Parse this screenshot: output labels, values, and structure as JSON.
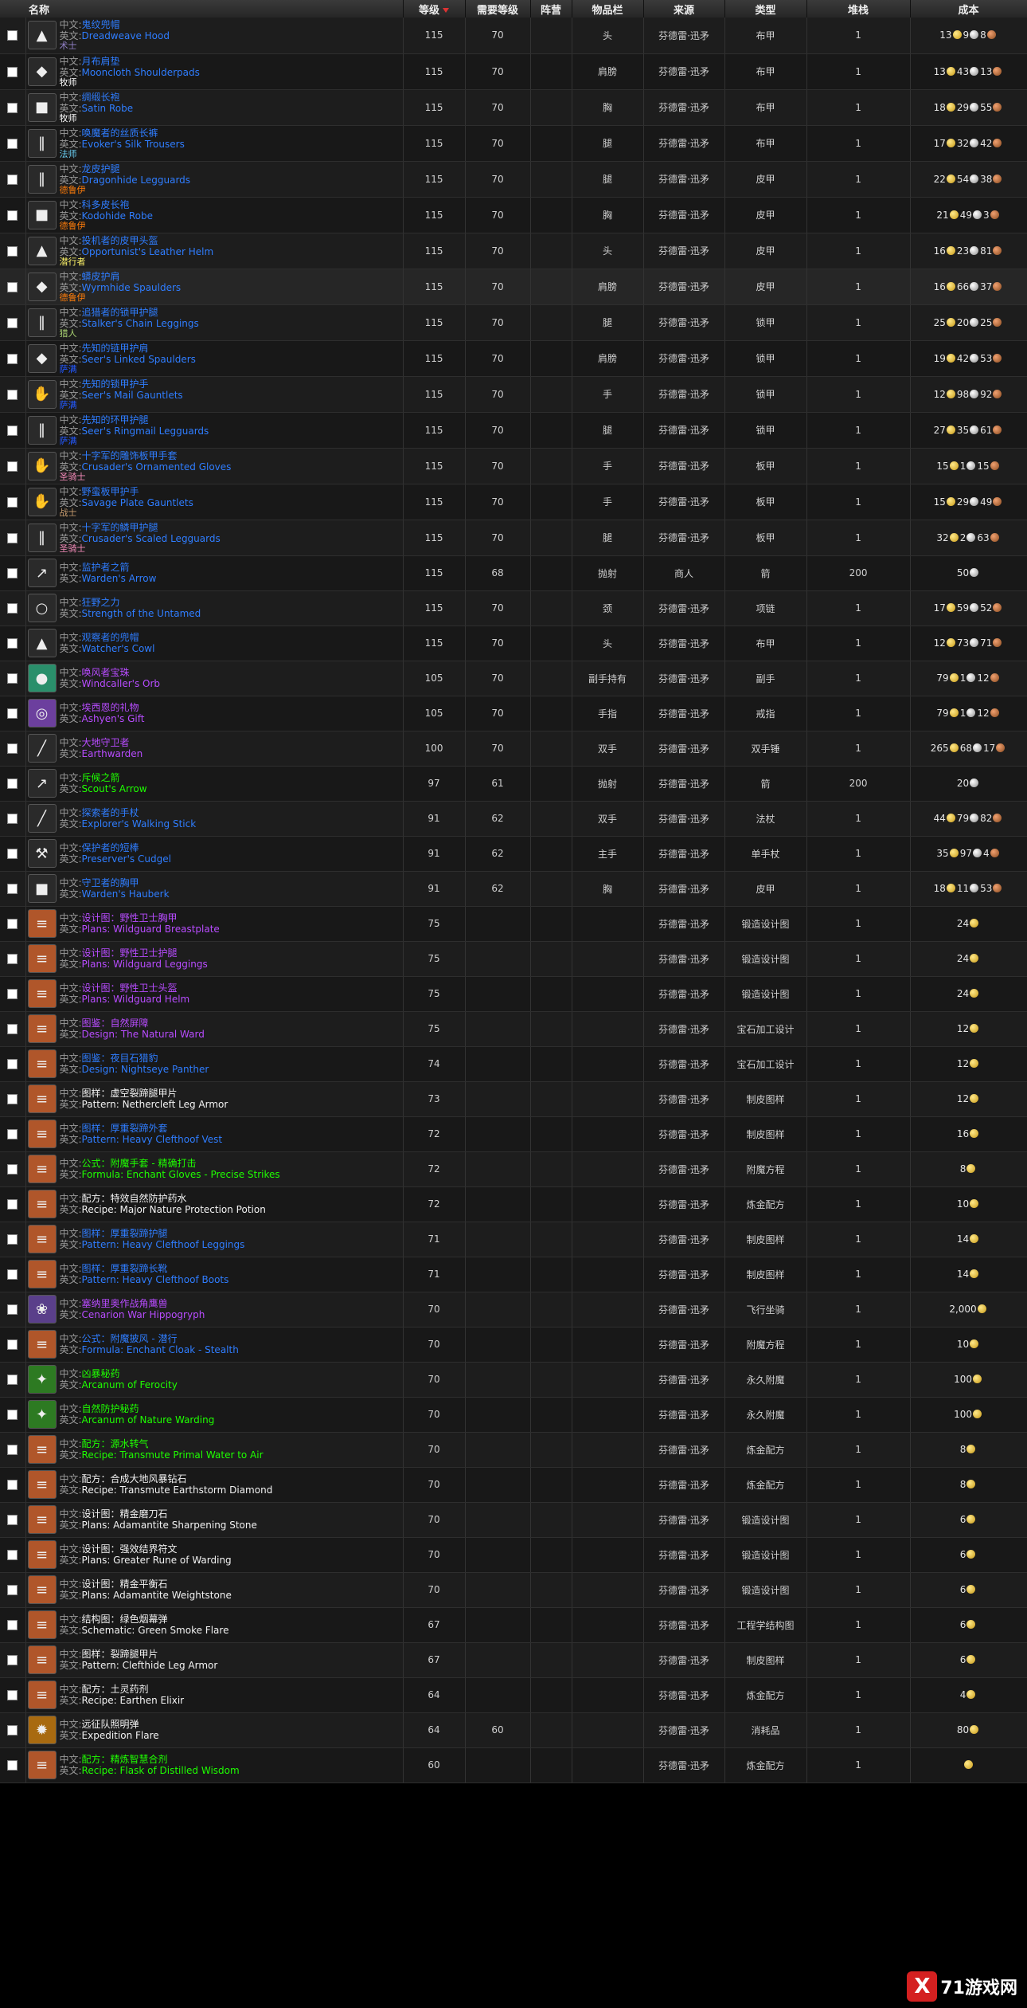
{
  "header": {
    "col_name": "名称",
    "col_level": "等级",
    "col_req_level": "需要等级",
    "col_faction": "阵营",
    "col_slot": "物品栏",
    "col_source": "来源",
    "col_type": "类型",
    "col_stack": "堆栈",
    "col_cost": "成本"
  },
  "labels": {
    "zh": "中文:",
    "en": "英文:"
  },
  "colors": {
    "blue": "#2f7dff",
    "purple": "#b84cff",
    "green": "#1eff00",
    "white": "#f2f2f2"
  },
  "watermark": {
    "logo": "X",
    "text": "71游戏网"
  },
  "rows": [
    {
      "icon": "hood-icon",
      "zh": "鬼纹兜帽",
      "en": "Dreadweave Hood",
      "cls": "术士",
      "cls_color": "#9482c9",
      "q": "blue",
      "level": "115",
      "req": "70",
      "slot": "头",
      "source": "芬德雷·迅矛",
      "type": "布甲",
      "stack": "1",
      "cost": {
        "g": "13",
        "s": "9",
        "c": "8"
      }
    },
    {
      "icon": "shoulder-icon",
      "zh": "月布肩垫",
      "en": "Mooncloth Shoulderpads",
      "cls": "牧师",
      "cls_color": "#ffffff",
      "q": "blue",
      "level": "115",
      "req": "70",
      "slot": "肩膀",
      "source": "芬德雷·迅矛",
      "type": "布甲",
      "stack": "1",
      "cost": {
        "g": "13",
        "s": "43",
        "c": "13"
      }
    },
    {
      "icon": "robe-icon",
      "zh": "绸缎长袍",
      "en": "Satin Robe",
      "cls": "牧师",
      "cls_color": "#ffffff",
      "q": "blue",
      "level": "115",
      "req": "70",
      "slot": "胸",
      "source": "芬德雷·迅矛",
      "type": "布甲",
      "stack": "1",
      "cost": {
        "g": "18",
        "s": "29",
        "c": "55"
      }
    },
    {
      "icon": "trousers-icon",
      "zh": "唤魔者的丝质长裤",
      "en": "Evoker's Silk Trousers",
      "cls": "法师",
      "cls_color": "#69ccf0",
      "q": "blue",
      "level": "115",
      "req": "70",
      "slot": "腿",
      "source": "芬德雷·迅矛",
      "type": "布甲",
      "stack": "1",
      "cost": {
        "g": "17",
        "s": "32",
        "c": "42"
      }
    },
    {
      "icon": "leggings-icon",
      "zh": "龙皮护腿",
      "en": "Dragonhide Legguards",
      "cls": "德鲁伊",
      "cls_color": "#ff7d0a",
      "q": "blue",
      "level": "115",
      "req": "70",
      "slot": "腿",
      "source": "芬德雷·迅矛",
      "type": "皮甲",
      "stack": "1",
      "cost": {
        "g": "22",
        "s": "54",
        "c": "38"
      }
    },
    {
      "icon": "robe-icon",
      "zh": "科多皮长袍",
      "en": "Kodohide Robe",
      "cls": "德鲁伊",
      "cls_color": "#ff7d0a",
      "q": "blue",
      "level": "115",
      "req": "70",
      "slot": "胸",
      "source": "芬德雷·迅矛",
      "type": "皮甲",
      "stack": "1",
      "cost": {
        "g": "21",
        "s": "49",
        "c": "3"
      }
    },
    {
      "icon": "helm-icon",
      "zh": "投机者的皮甲头盔",
      "en": "Opportunist's Leather Helm",
      "cls": "潜行者",
      "cls_color": "#fff569",
      "q": "blue",
      "level": "115",
      "req": "70",
      "slot": "头",
      "source": "芬德雷·迅矛",
      "type": "皮甲",
      "stack": "1",
      "cost": {
        "g": "16",
        "s": "23",
        "c": "81"
      }
    },
    {
      "icon": "shoulder-icon",
      "zh": "蟒皮护肩",
      "en": "Wyrmhide Spaulders",
      "cls": "德鲁伊",
      "cls_color": "#ff7d0a",
      "q": "blue",
      "level": "115",
      "req": "70",
      "slot": "肩膀",
      "source": "芬德雷·迅矛",
      "type": "皮甲",
      "stack": "1",
      "cost": {
        "g": "16",
        "s": "66",
        "c": "37"
      },
      "hl": true
    },
    {
      "icon": "leggings-icon",
      "zh": "追猎者的锁甲护腿",
      "en": "Stalker's Chain Leggings",
      "cls": "猎人",
      "cls_color": "#abd473",
      "q": "blue",
      "level": "115",
      "req": "70",
      "slot": "腿",
      "source": "芬德雷·迅矛",
      "type": "锁甲",
      "stack": "1",
      "cost": {
        "g": "25",
        "s": "20",
        "c": "25"
      }
    },
    {
      "icon": "shoulder-icon",
      "zh": "先知的链甲护肩",
      "en": "Seer's Linked Spaulders",
      "cls": "萨满",
      "cls_color": "#2459ff",
      "q": "blue",
      "level": "115",
      "req": "70",
      "slot": "肩膀",
      "source": "芬德雷·迅矛",
      "type": "锁甲",
      "stack": "1",
      "cost": {
        "g": "19",
        "s": "42",
        "c": "53"
      }
    },
    {
      "icon": "gauntlets-icon",
      "zh": "先知的锁甲护手",
      "en": "Seer's Mail Gauntlets",
      "cls": "萨满",
      "cls_color": "#2459ff",
      "q": "blue",
      "level": "115",
      "req": "70",
      "slot": "手",
      "source": "芬德雷·迅矛",
      "type": "锁甲",
      "stack": "1",
      "cost": {
        "g": "12",
        "s": "98",
        "c": "92"
      }
    },
    {
      "icon": "leggings-icon",
      "zh": "先知的环甲护腿",
      "en": "Seer's Ringmail Legguards",
      "cls": "萨满",
      "cls_color": "#2459ff",
      "q": "blue",
      "level": "115",
      "req": "70",
      "slot": "腿",
      "source": "芬德雷·迅矛",
      "type": "锁甲",
      "stack": "1",
      "cost": {
        "g": "27",
        "s": "35",
        "c": "61"
      }
    },
    {
      "icon": "gauntlets-icon",
      "zh": "十字军的雕饰板甲手套",
      "en": "Crusader's Ornamented Gloves",
      "cls": "圣骑士",
      "cls_color": "#f58cba",
      "q": "blue",
      "level": "115",
      "req": "70",
      "slot": "手",
      "source": "芬德雷·迅矛",
      "type": "板甲",
      "stack": "1",
      "cost": {
        "g": "15",
        "s": "1",
        "c": "15"
      }
    },
    {
      "icon": "gauntlets-icon",
      "zh": "野蛮板甲护手",
      "en": "Savage Plate Gauntlets",
      "cls": "战士",
      "cls_color": "#c79c6e",
      "q": "blue",
      "level": "115",
      "req": "70",
      "slot": "手",
      "source": "芬德雷·迅矛",
      "type": "板甲",
      "stack": "1",
      "cost": {
        "g": "15",
        "s": "29",
        "c": "49"
      }
    },
    {
      "icon": "leggings-icon",
      "zh": "十字军的鳞甲护腿",
      "en": "Crusader's Scaled Legguards",
      "cls": "圣骑士",
      "cls_color": "#f58cba",
      "q": "blue",
      "level": "115",
      "req": "70",
      "slot": "腿",
      "source": "芬德雷·迅矛",
      "type": "板甲",
      "stack": "1",
      "cost": {
        "g": "32",
        "s": "2",
        "c": "63"
      }
    },
    {
      "icon": "arrow-icon",
      "zh": "监护者之箭",
      "en": "Warden's Arrow",
      "cls": "",
      "cls_color": "",
      "q": "blue",
      "level": "115",
      "req": "68",
      "slot": "抛射",
      "source": "商人",
      "type": "箭",
      "stack": "200",
      "cost": {
        "s": "50"
      },
      "short": true
    },
    {
      "icon": "necklace-icon",
      "zh": "狂野之力",
      "en": "Strength of the Untamed",
      "cls": "",
      "cls_color": "",
      "q": "blue",
      "level": "115",
      "req": "70",
      "slot": "颈",
      "source": "芬德雷·迅矛",
      "type": "项链",
      "stack": "1",
      "cost": {
        "g": "17",
        "s": "59",
        "c": "52"
      },
      "short": true
    },
    {
      "icon": "hood-icon",
      "zh": "观察者的兜帽",
      "en": "Watcher's Cowl",
      "cls": "",
      "cls_color": "",
      "q": "blue",
      "level": "115",
      "req": "70",
      "slot": "头",
      "source": "芬德雷·迅矛",
      "type": "布甲",
      "stack": "1",
      "cost": {
        "g": "12",
        "s": "73",
        "c": "71"
      },
      "short": true
    },
    {
      "icon": "orb-icon",
      "zh": "唤风者宝珠",
      "en": "Windcaller's Orb",
      "cls": "",
      "cls_color": "",
      "q": "purple",
      "level": "105",
      "req": "70",
      "slot": "副手持有",
      "source": "芬德雷·迅矛",
      "type": "副手",
      "stack": "1",
      "cost": {
        "g": "79",
        "s": "1",
        "c": "12"
      },
      "short": true
    },
    {
      "icon": "ring-icon",
      "zh": "埃西恩的礼物",
      "en": "Ashyen's Gift",
      "cls": "",
      "cls_color": "",
      "q": "purple",
      "level": "105",
      "req": "70",
      "slot": "手指",
      "source": "芬德雷·迅矛",
      "type": "戒指",
      "stack": "1",
      "cost": {
        "g": "79",
        "s": "1",
        "c": "12"
      },
      "short": true
    },
    {
      "icon": "staff-icon",
      "zh": "大地守卫者",
      "en": "Earthwarden",
      "cls": "",
      "cls_color": "",
      "q": "purple",
      "level": "100",
      "req": "70",
      "slot": "双手",
      "source": "芬德雷·迅矛",
      "type": "双手锤",
      "stack": "1",
      "cost": {
        "g": "265",
        "s": "68",
        "c": "17"
      },
      "short": true
    },
    {
      "icon": "arrow-icon",
      "zh": "斥候之箭",
      "en": "Scout's Arrow",
      "cls": "",
      "cls_color": "",
      "q": "green",
      "level": "97",
      "req": "61",
      "slot": "抛射",
      "source": "芬德雷·迅矛",
      "type": "箭",
      "stack": "200",
      "cost": {
        "s": "20"
      },
      "short": true
    },
    {
      "icon": "staff-icon",
      "zh": "探索者的手杖",
      "en": "Explorer's Walking Stick",
      "cls": "",
      "cls_color": "",
      "q": "blue",
      "level": "91",
      "req": "62",
      "slot": "双手",
      "source": "芬德雷·迅矛",
      "type": "法杖",
      "stack": "1",
      "cost": {
        "g": "44",
        "s": "79",
        "c": "82"
      },
      "short": true
    },
    {
      "icon": "mace-icon",
      "zh": "保护者的短棒",
      "en": "Preserver's Cudgel",
      "cls": "",
      "cls_color": "",
      "q": "blue",
      "level": "91",
      "req": "62",
      "slot": "主手",
      "source": "芬德雷·迅矛",
      "type": "单手杖",
      "stack": "1",
      "cost": {
        "g": "35",
        "s": "97",
        "c": "4"
      },
      "short": true
    },
    {
      "icon": "hauberk-icon",
      "zh": "守卫者的胸甲",
      "en": "Warden's Hauberk",
      "cls": "",
      "cls_color": "",
      "q": "blue",
      "level": "91",
      "req": "62",
      "slot": "胸",
      "source": "芬德雷·迅矛",
      "type": "皮甲",
      "stack": "1",
      "cost": {
        "g": "18",
        "s": "11",
        "c": "53"
      },
      "short": true
    },
    {
      "icon": "scroll-icon",
      "zh": "设计图：野性卫士胸甲",
      "en": "Plans: Wildguard Breastplate",
      "cls": "",
      "cls_color": "",
      "q": "purple",
      "level": "75",
      "req": "",
      "slot": "",
      "source": "芬德雷·迅矛",
      "type": "锻造设计图",
      "stack": "1",
      "cost": {
        "g": "24"
      },
      "short": true
    },
    {
      "icon": "scroll-icon",
      "zh": "设计图：野性卫士护腿",
      "en": "Plans: Wildguard Leggings",
      "cls": "",
      "cls_color": "",
      "q": "purple",
      "level": "75",
      "req": "",
      "slot": "",
      "source": "芬德雷·迅矛",
      "type": "锻造设计图",
      "stack": "1",
      "cost": {
        "g": "24"
      },
      "short": true
    },
    {
      "icon": "scroll-icon",
      "zh": "设计图：野性卫士头盔",
      "en": "Plans: Wildguard Helm",
      "cls": "",
      "cls_color": "",
      "q": "purple",
      "level": "75",
      "req": "",
      "slot": "",
      "source": "芬德雷·迅矛",
      "type": "锻造设计图",
      "stack": "1",
      "cost": {
        "g": "24"
      },
      "short": true
    },
    {
      "icon": "scroll-icon",
      "zh": "图鉴：自然屏障",
      "en": "Design: The Natural Ward",
      "cls": "",
      "cls_color": "",
      "q": "purple",
      "level": "75",
      "req": "",
      "slot": "",
      "source": "芬德雷·迅矛",
      "type": "宝石加工设计",
      "stack": "1",
      "cost": {
        "g": "12"
      },
      "short": true
    },
    {
      "icon": "scroll-icon",
      "zh": "图鉴：夜目石猎豹",
      "en": "Design: Nightseye Panther",
      "cls": "",
      "cls_color": "",
      "q": "blue",
      "level": "74",
      "req": "",
      "slot": "",
      "source": "芬德雷·迅矛",
      "type": "宝石加工设计",
      "stack": "1",
      "cost": {
        "g": "12"
      },
      "short": true
    },
    {
      "icon": "scroll-icon",
      "zh": "图样：虚空裂蹄腿甲片",
      "en": "Pattern: Nethercleft Leg Armor",
      "cls": "",
      "cls_color": "",
      "q": "white",
      "level": "73",
      "req": "",
      "slot": "",
      "source": "芬德雷·迅矛",
      "type": "制皮图样",
      "stack": "1",
      "cost": {
        "g": "12"
      },
      "short": true
    },
    {
      "icon": "scroll-icon",
      "zh": "图样：厚重裂蹄外套",
      "en": "Pattern: Heavy Clefthoof Vest",
      "cls": "",
      "cls_color": "",
      "q": "blue",
      "level": "72",
      "req": "",
      "slot": "",
      "source": "芬德雷·迅矛",
      "type": "制皮图样",
      "stack": "1",
      "cost": {
        "g": "16"
      },
      "short": true
    },
    {
      "icon": "scroll-icon",
      "zh": "公式：附魔手套 - 精确打击",
      "en": "Formula: Enchant Gloves - Precise Strikes",
      "cls": "",
      "cls_color": "",
      "q": "green",
      "level": "72",
      "req": "",
      "slot": "",
      "source": "芬德雷·迅矛",
      "type": "附魔方程",
      "stack": "1",
      "cost": {
        "g": "8"
      },
      "short": true
    },
    {
      "icon": "scroll-icon",
      "zh": "配方：特效自然防护药水",
      "en": "Recipe: Major Nature Protection Potion",
      "cls": "",
      "cls_color": "",
      "q": "white",
      "level": "72",
      "req": "",
      "slot": "",
      "source": "芬德雷·迅矛",
      "type": "炼金配方",
      "stack": "1",
      "cost": {
        "g": "10"
      },
      "short": true
    },
    {
      "icon": "scroll-icon",
      "zh": "图样：厚重裂蹄护腿",
      "en": "Pattern: Heavy Clefthoof Leggings",
      "cls": "",
      "cls_color": "",
      "q": "blue",
      "level": "71",
      "req": "",
      "slot": "",
      "source": "芬德雷·迅矛",
      "type": "制皮图样",
      "stack": "1",
      "cost": {
        "g": "14"
      },
      "short": true
    },
    {
      "icon": "scroll-icon",
      "zh": "图样：厚重裂蹄长靴",
      "en": "Pattern: Heavy Clefthoof Boots",
      "cls": "",
      "cls_color": "",
      "q": "blue",
      "level": "71",
      "req": "",
      "slot": "",
      "source": "芬德雷·迅矛",
      "type": "制皮图样",
      "stack": "1",
      "cost": {
        "g": "14"
      },
      "short": true
    },
    {
      "icon": "hippogryph-icon",
      "zh": "塞纳里奥作战角鹰兽",
      "en": "Cenarion War Hippogryph",
      "cls": "",
      "cls_color": "",
      "q": "purple",
      "level": "70",
      "req": "",
      "slot": "",
      "source": "芬德雷·迅矛",
      "type": "飞行坐骑",
      "stack": "1",
      "cost": {
        "g": "2,000"
      },
      "short": true
    },
    {
      "icon": "scroll-icon",
      "zh": "公式：附魔披风 - 潜行",
      "en": "Formula: Enchant Cloak - Stealth",
      "cls": "",
      "cls_color": "",
      "q": "blue",
      "level": "70",
      "req": "",
      "slot": "",
      "source": "芬德雷·迅矛",
      "type": "附魔方程",
      "stack": "1",
      "cost": {
        "g": "10"
      },
      "short": true
    },
    {
      "icon": "arcanum-icon",
      "zh": "凶暴秘药",
      "en": "Arcanum of Ferocity",
      "cls": "",
      "cls_color": "",
      "q": "green",
      "level": "70",
      "req": "",
      "slot": "",
      "source": "芬德雷·迅矛",
      "type": "永久附魔",
      "stack": "1",
      "cost": {
        "g": "100"
      },
      "short": true
    },
    {
      "icon": "arcanum-icon",
      "zh": "自然防护秘药",
      "en": "Arcanum of Nature Warding",
      "cls": "",
      "cls_color": "",
      "q": "green",
      "level": "70",
      "req": "",
      "slot": "",
      "source": "芬德雷·迅矛",
      "type": "永久附魔",
      "stack": "1",
      "cost": {
        "g": "100"
      },
      "short": true
    },
    {
      "icon": "scroll-icon",
      "zh": "配方：源水转气",
      "en": "Recipe: Transmute Primal Water to Air",
      "cls": "",
      "cls_color": "",
      "q": "green",
      "level": "70",
      "req": "",
      "slot": "",
      "source": "芬德雷·迅矛",
      "type": "炼金配方",
      "stack": "1",
      "cost": {
        "g": "8"
      },
      "short": true
    },
    {
      "icon": "scroll-icon",
      "zh": "配方：合成大地风暴钻石",
      "en": "Recipe: Transmute Earthstorm Diamond",
      "cls": "",
      "cls_color": "",
      "q": "white",
      "level": "70",
      "req": "",
      "slot": "",
      "source": "芬德雷·迅矛",
      "type": "炼金配方",
      "stack": "1",
      "cost": {
        "g": "8"
      },
      "short": true
    },
    {
      "icon": "scroll-icon",
      "zh": "设计图：精金磨刀石",
      "en": "Plans: Adamantite Sharpening Stone",
      "cls": "",
      "cls_color": "",
      "q": "white",
      "level": "70",
      "req": "",
      "slot": "",
      "source": "芬德雷·迅矛",
      "type": "锻造设计图",
      "stack": "1",
      "cost": {
        "g": "6"
      },
      "short": true
    },
    {
      "icon": "scroll-icon",
      "zh": "设计图：强效结界符文",
      "en": "Plans: Greater Rune of Warding",
      "cls": "",
      "cls_color": "",
      "q": "white",
      "level": "70",
      "req": "",
      "slot": "",
      "source": "芬德雷·迅矛",
      "type": "锻造设计图",
      "stack": "1",
      "cost": {
        "g": "6"
      },
      "short": true
    },
    {
      "icon": "scroll-icon",
      "zh": "设计图：精金平衡石",
      "en": "Plans: Adamantite Weightstone",
      "cls": "",
      "cls_color": "",
      "q": "white",
      "level": "70",
      "req": "",
      "slot": "",
      "source": "芬德雷·迅矛",
      "type": "锻造设计图",
      "stack": "1",
      "cost": {
        "g": "6"
      },
      "short": true
    },
    {
      "icon": "scroll-icon",
      "zh": "结构图：绿色烟幕弹",
      "en": "Schematic: Green Smoke Flare",
      "cls": "",
      "cls_color": "",
      "q": "white",
      "level": "67",
      "req": "",
      "slot": "",
      "source": "芬德雷·迅矛",
      "type": "工程学结构图",
      "stack": "1",
      "cost": {
        "g": "6"
      },
      "short": true
    },
    {
      "icon": "scroll-icon",
      "zh": "图样：裂蹄腿甲片",
      "en": "Pattern: Clefthide Leg Armor",
      "cls": "",
      "cls_color": "",
      "q": "white",
      "level": "67",
      "req": "",
      "slot": "",
      "source": "芬德雷·迅矛",
      "type": "制皮图样",
      "stack": "1",
      "cost": {
        "g": "6"
      },
      "short": true
    },
    {
      "icon": "scroll-icon",
      "zh": "配方：土灵药剂",
      "en": "Recipe: Earthen Elixir",
      "cls": "",
      "cls_color": "",
      "q": "white",
      "level": "64",
      "req": "",
      "slot": "",
      "source": "芬德雷·迅矛",
      "type": "炼金配方",
      "stack": "1",
      "cost": {
        "g": "4"
      },
      "short": true
    },
    {
      "icon": "flare-icon",
      "zh": "远征队照明弹",
      "en": "Expedition Flare",
      "cls": "",
      "cls_color": "",
      "q": "white",
      "level": "64",
      "req": "60",
      "slot": "",
      "source": "芬德雷·迅矛",
      "type": "消耗品",
      "stack": "1",
      "cost": {
        "g": "80"
      },
      "short": true
    },
    {
      "icon": "scroll-icon",
      "zh": "配方：精炼智慧合剂",
      "en": "Recipe: Flask of Distilled Wisdom",
      "cls": "",
      "cls_color": "",
      "q": "green",
      "level": "60",
      "req": "",
      "slot": "",
      "source": "芬德雷·迅矛",
      "type": "炼金配方",
      "stack": "1",
      "cost": {
        "g": ""
      },
      "short": true
    }
  ]
}
